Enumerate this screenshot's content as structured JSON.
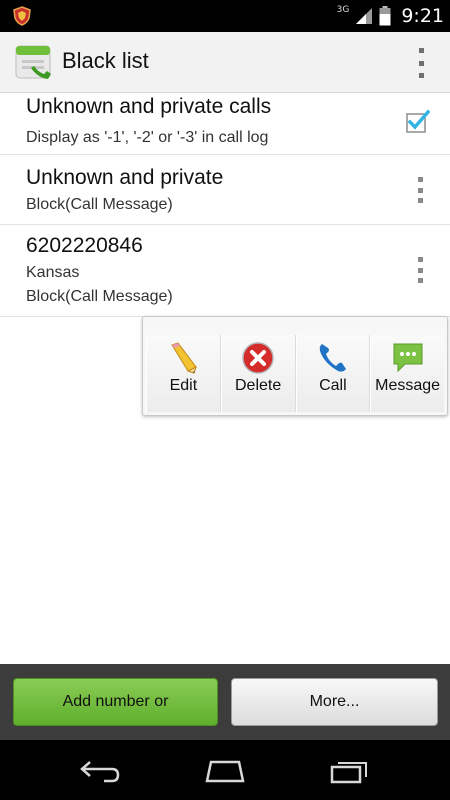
{
  "status_bar": {
    "network_type": "3G",
    "time": "9:21",
    "icons": [
      "shield-notification-icon",
      "signal-icon",
      "battery-icon"
    ]
  },
  "action_bar": {
    "title": "Black list",
    "app_icon": "phone-blocklist-icon",
    "overflow_icon": "overflow-menu-icon"
  },
  "list": {
    "items": [
      {
        "title": "Unknown and private calls",
        "subtitle": "Display as '-1', '-2' or '-3' in call log",
        "checked": true
      },
      {
        "title": "Unknown and private",
        "subtitle": "Block(Call Message)"
      },
      {
        "title": "6202220846",
        "location": "Kansas",
        "subtitle": "Block(Call Message)"
      }
    ]
  },
  "quick_actions": {
    "items": [
      {
        "label": "Edit",
        "icon": "pencil-icon"
      },
      {
        "label": "Delete",
        "icon": "delete-x-icon"
      },
      {
        "label": "Call",
        "icon": "phone-icon"
      },
      {
        "label": "Message",
        "icon": "message-bubble-icon"
      }
    ]
  },
  "bottom_bar": {
    "add_label": "Add number or",
    "more_label": "More..."
  },
  "nav_bar": {
    "icons": [
      "back-icon",
      "home-icon",
      "recent-apps-icon"
    ]
  },
  "colors": {
    "accent_green": "#5faf2c",
    "checkbox_blue": "#33b5e5",
    "delete_red": "#d52b2b"
  }
}
